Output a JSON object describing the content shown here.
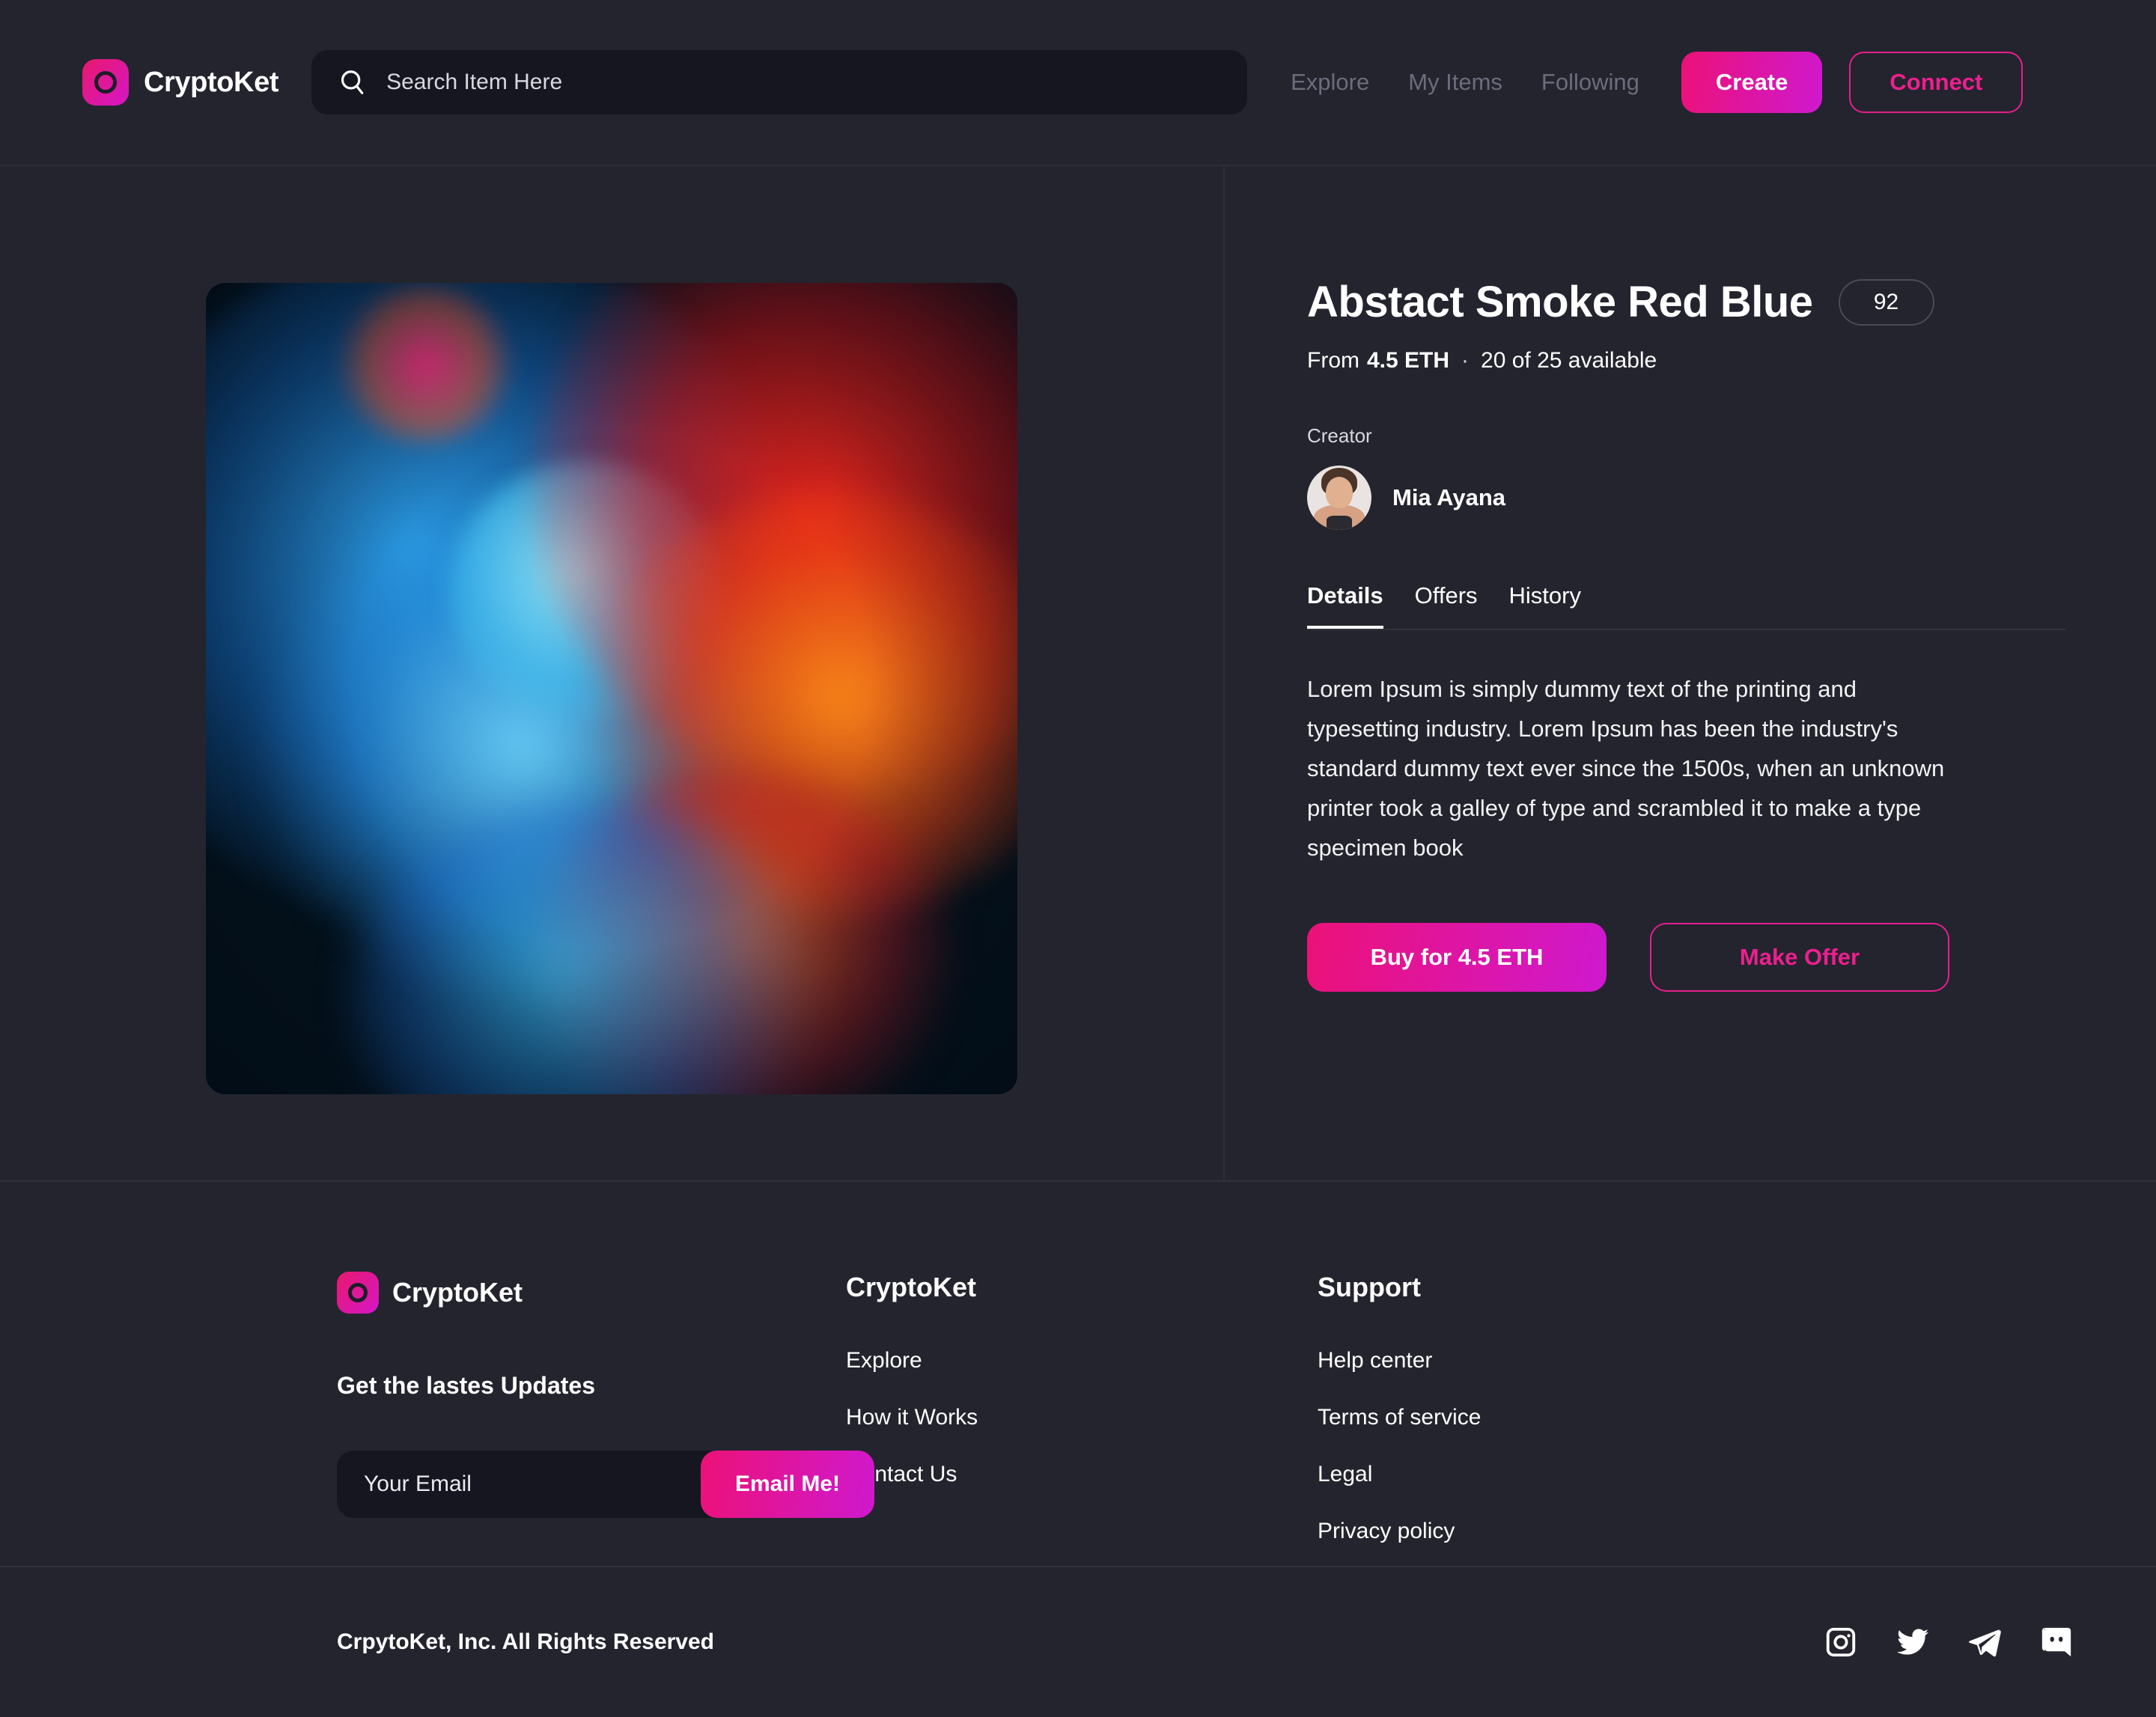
{
  "brand": {
    "name": "CryptoKet",
    "logo_icon": "circle-ring-logo-icon"
  },
  "header": {
    "search": {
      "placeholder": "Search Item Here",
      "value": "",
      "icon": "search-icon"
    },
    "nav": [
      {
        "label": "Explore"
      },
      {
        "label": "My Items"
      },
      {
        "label": "Following"
      }
    ],
    "create_label": "Create",
    "connect_label": "Connect"
  },
  "item": {
    "artwork_alt": "Abstract red and blue smoke artwork",
    "title": "Abstact Smoke Red Blue",
    "like_count": "92",
    "price_prefix": "From",
    "price": "4.5 ETH",
    "separator": "·",
    "availability": "20 of 25 available",
    "creator_label": "Creator",
    "creator_name": "Mia Ayana",
    "tabs": [
      {
        "label": "Details",
        "active": true
      },
      {
        "label": "Offers",
        "active": false
      },
      {
        "label": "History",
        "active": false
      }
    ],
    "description": "Lorem Ipsum is simply dummy text of the printing and typesetting industry. Lorem Ipsum has been the industry's standard dummy text ever since the 1500s, when an unknown printer took a galley of type and scrambled it to make a type specimen book",
    "buy_label": "Buy for 4.5 ETH",
    "offer_label": "Make Offer"
  },
  "footer": {
    "brand_name": "CryptoKet",
    "updates_heading": "Get the lastes Updates",
    "email": {
      "placeholder": "Your Email",
      "value": "",
      "button_label": "Email Me!"
    },
    "columns": [
      {
        "heading": "CryptoKet",
        "links": [
          {
            "label": "Explore"
          },
          {
            "label": "How it Works"
          },
          {
            "label": "Contact Us"
          }
        ]
      },
      {
        "heading": "Support",
        "links": [
          {
            "label": "Help center"
          },
          {
            "label": "Terms of service"
          },
          {
            "label": "Legal"
          },
          {
            "label": "Privacy policy"
          }
        ]
      }
    ],
    "copyright": "CrpytoKet, Inc. All Rights Reserved",
    "socials": [
      {
        "name": "instagram-icon"
      },
      {
        "name": "twitter-icon"
      },
      {
        "name": "telegram-icon"
      },
      {
        "name": "discord-icon"
      }
    ]
  },
  "colors": {
    "background": "#24242e",
    "surface": "#161620",
    "accent_pink": "#ec1177",
    "accent_purple": "#cf19cf",
    "accent_outline": "#e51f8f",
    "text_primary": "#ffffff",
    "text_muted": "#6c6c7c",
    "divider": "#32323e"
  }
}
